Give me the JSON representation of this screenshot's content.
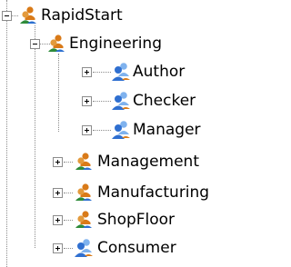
{
  "tree": {
    "root": {
      "label": "RapidStart",
      "icon": "user-group-icon",
      "expanded": true,
      "children": [
        {
          "label": "Engineering",
          "icon": "user-group-icon",
          "expanded": true,
          "children": [
            {
              "label": "Author",
              "icon": "role-icon",
              "expanded": false
            },
            {
              "label": "Checker",
              "icon": "role-icon",
              "expanded": false
            },
            {
              "label": "Manager",
              "icon": "role-icon",
              "expanded": false
            }
          ]
        },
        {
          "label": "Management",
          "icon": "user-group-icon",
          "expanded": false
        },
        {
          "label": "Manufacturing",
          "icon": "user-group-icon",
          "expanded": false
        },
        {
          "label": "ShopFloor",
          "icon": "user-group-icon",
          "expanded": false
        },
        {
          "label": "Consumer",
          "icon": "role-icon",
          "expanded": false
        }
      ]
    }
  },
  "colors": {
    "connector": "#8c8c8c",
    "group_person_primary": "#d97a18",
    "group_person_secondary": "#2e8b3a",
    "role_person_primary": "#2f6fd0",
    "role_person_secondary": "#7fb2ee"
  }
}
